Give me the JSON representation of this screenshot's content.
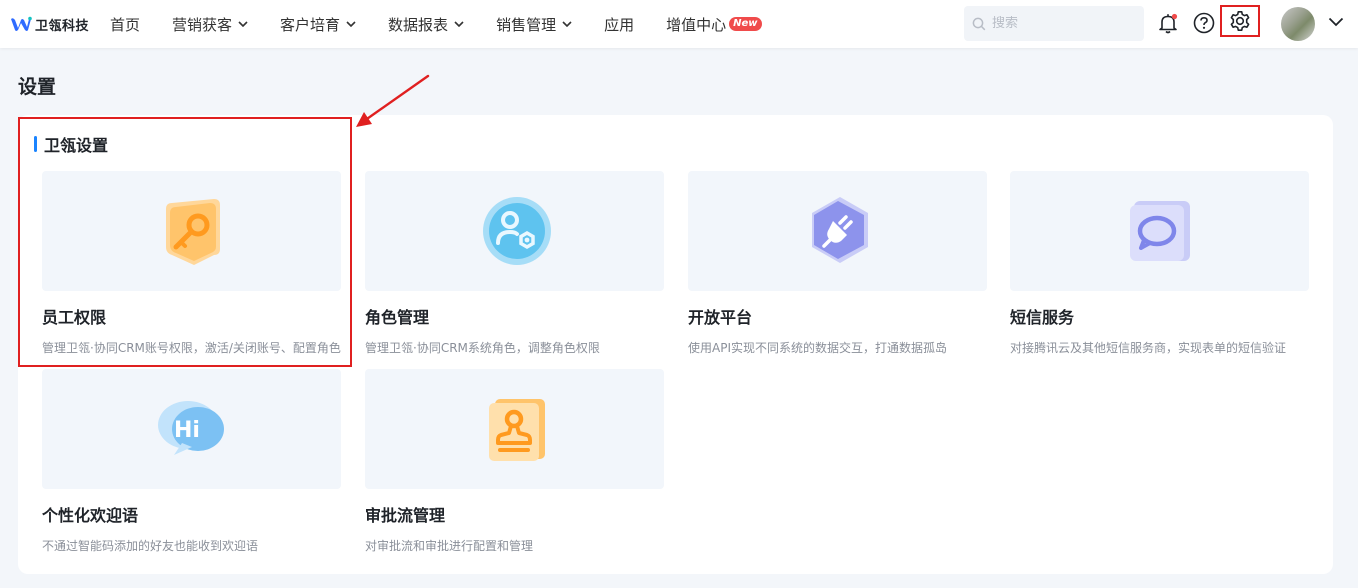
{
  "brand": {
    "logo_text": "卫瓴科技",
    "accent": "#1b84ff"
  },
  "nav": {
    "items": [
      {
        "label": "首页",
        "has_dropdown": false
      },
      {
        "label": "营销获客",
        "has_dropdown": true
      },
      {
        "label": "客户培育",
        "has_dropdown": true
      },
      {
        "label": "数据报表",
        "has_dropdown": true
      },
      {
        "label": "销售管理",
        "has_dropdown": true
      },
      {
        "label": "应用",
        "has_dropdown": false
      },
      {
        "label": "增值中心",
        "has_dropdown": false,
        "badge": "New"
      }
    ]
  },
  "header": {
    "search_placeholder": "搜索",
    "icons": [
      "bell-icon",
      "help-icon",
      "gear-icon",
      "avatar",
      "chevron-down-icon"
    ]
  },
  "page": {
    "title": "设置"
  },
  "section": {
    "title": "卫瓴设置",
    "cards": [
      {
        "name": "员工权限",
        "desc": "管理卫瓴·协同CRM账号权限，激活/关闭账号、配置角色",
        "icon": "key-icon",
        "highlighted": true
      },
      {
        "name": "角色管理",
        "desc": "管理卫瓴·协同CRM系统角色，调整角色权限",
        "icon": "role-icon"
      },
      {
        "name": "开放平台",
        "desc": "使用API实现不同系统的数据交互，打通数据孤岛",
        "icon": "plug-icon"
      },
      {
        "name": "短信服务",
        "desc": "对接腾讯云及其他短信服务商，实现表单的短信验证",
        "icon": "message-icon"
      },
      {
        "name": "个性化欢迎语",
        "desc": "不通过智能码添加的好友也能收到欢迎语",
        "icon": "hi-bubble-icon"
      },
      {
        "name": "审批流管理",
        "desc": "对审批流和审批进行配置和管理",
        "icon": "stamp-icon"
      }
    ]
  },
  "colors": {
    "highlight": "#e02020",
    "badge": "#f04b4b"
  }
}
